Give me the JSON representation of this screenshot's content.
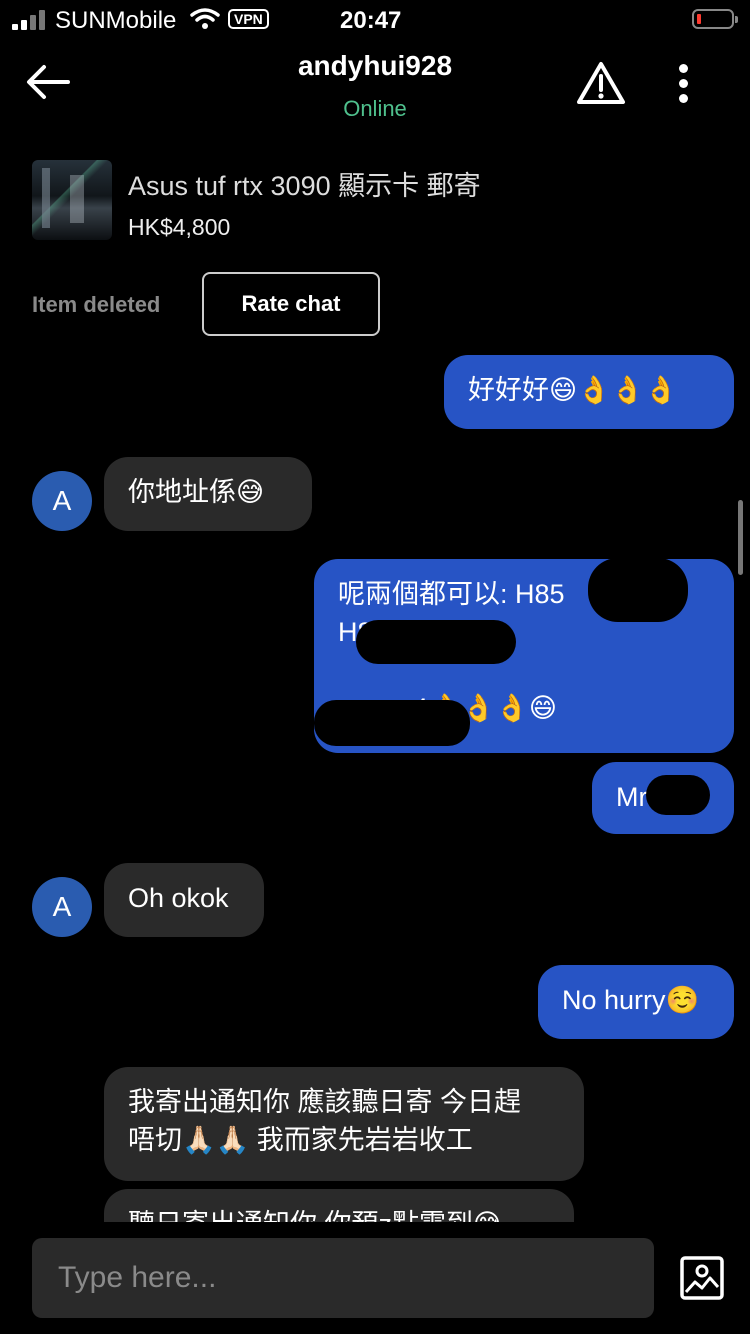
{
  "status_bar": {
    "carrier": "SUNMobile",
    "vpn": "VPN",
    "time": "20:47",
    "battery_level": 0.08
  },
  "header": {
    "username": "andyhui928",
    "presence": "Online"
  },
  "listing": {
    "title": "Asus tuf rtx 3090 顯示卡 郵寄",
    "price": "HK$4,800",
    "status": "Item deleted",
    "rate_label": "Rate chat"
  },
  "messages": [
    {
      "from": "me",
      "text": "好好好😄👌👌👌"
    },
    {
      "from": "them",
      "avatar": "A",
      "text": "你地址係😅"
    },
    {
      "from": "me",
      "text": "呢兩個都可以: H85          /\nH85\n\n          4👌👌👌😄"
    },
    {
      "from": "me",
      "text": "Mr"
    },
    {
      "from": "them",
      "avatar": "A",
      "text": "Oh okok"
    },
    {
      "from": "me",
      "text": "No hurry☺️"
    },
    {
      "from": "them",
      "text": "我寄出通知你 應該聽日寄 今日趕\n唔切🙏🏻🙏🏻 我而家先岩岩收工"
    },
    {
      "from": "them",
      "text": "聽日寄出通知你 你預z點需到😅"
    }
  ],
  "composer": {
    "placeholder": "Type here..."
  },
  "colors": {
    "my_bubble": "#2754c5",
    "their_bubble": "#2a2a2a",
    "online": "#4fc08d",
    "avatar": "#2a5cb0"
  },
  "icons": [
    "back-arrow-icon",
    "warning-icon",
    "more-vertical-icon",
    "photo-icon",
    "wifi-icon",
    "signal-icon",
    "battery-icon"
  ]
}
